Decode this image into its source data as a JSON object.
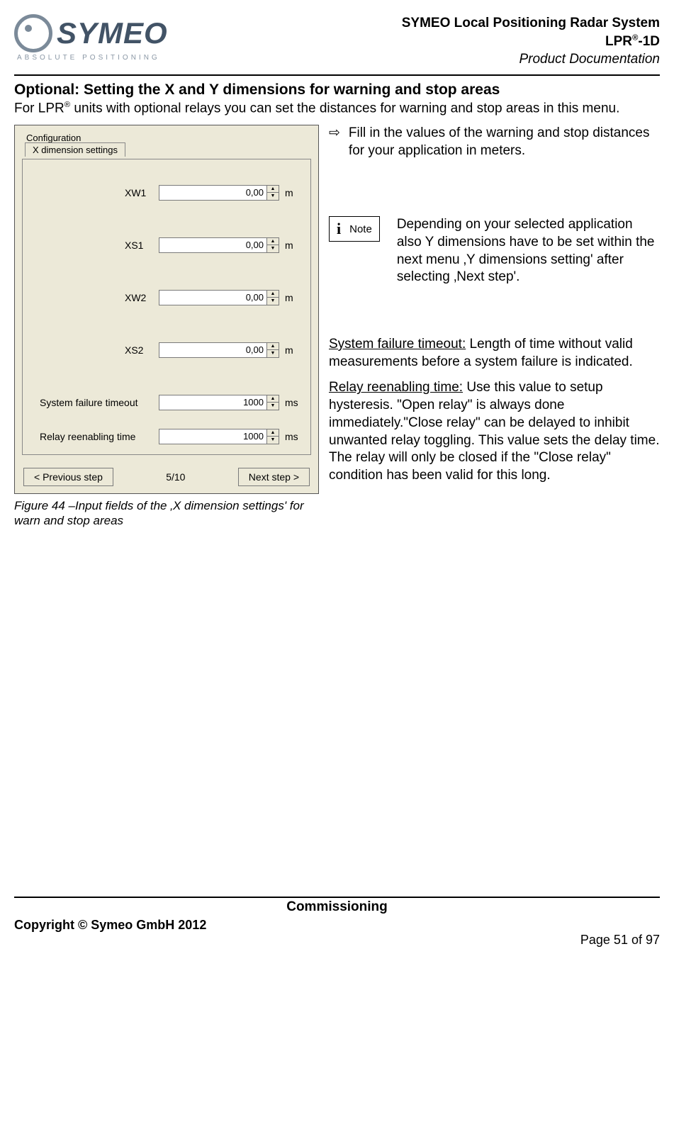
{
  "header": {
    "logo_text": "SYMEO",
    "logo_sub": "ABSOLUTE POSITIONING",
    "title_line1": "SYMEO Local Positioning Radar System",
    "title_line2_a": "LPR",
    "title_line2_sup": "®",
    "title_line2_b": "-1D",
    "title_line3": "Product Documentation"
  },
  "section": {
    "heading": "Optional: Setting the X and Y dimensions for warning and stop areas",
    "intro_a": "For LPR",
    "intro_sup": "®",
    "intro_b": " units with optional relays you can set the distances for warning and stop areas in this menu."
  },
  "dialog": {
    "group_label": "Configuration",
    "tab_label": "X dimension settings",
    "rows": [
      {
        "label": "XW1",
        "value": "0,00",
        "unit": "m"
      },
      {
        "label": "XS1",
        "value": "0,00",
        "unit": "m"
      },
      {
        "label": "XW2",
        "value": "0,00",
        "unit": "m"
      },
      {
        "label": "XS2",
        "value": "0,00",
        "unit": "m"
      },
      {
        "label": "System failure timeout",
        "value": "1000",
        "unit": "ms"
      },
      {
        "label": "Relay reenabling time",
        "value": "1000",
        "unit": "ms"
      }
    ],
    "prev_btn": "< Previous step",
    "step_indicator": "5/10",
    "next_btn": "Next step >"
  },
  "figure_caption": "Figure 44 –Input fields of the ‚X dimension settings' for warn and stop areas",
  "right": {
    "bullet_arrow": "⇨",
    "bullet_text": "Fill in the values of the warning and stop distances for your application in meters.",
    "note_label": "Note",
    "note_body": "Depending on your selected application also Y dimensions have to be set within the next menu ‚Y dimensions setting' after selecting ‚Next step'.",
    "sft_label": "System failure timeout:",
    "sft_body": " Length of time without valid measurements before a system failure is indicated.",
    "rrt_label": "Relay reenabling time:",
    "rrt_body": "  Use this value to setup hysteresis. \"Open relay\" is always done immediately.\"Close relay\" can be delayed to inhibit unwanted relay toggling. This value sets the delay time. The relay will only be closed if the \"Close relay\" condition has been valid for this long."
  },
  "footer": {
    "center": "Commissioning",
    "copyright": "Copyright © Symeo GmbH 2012",
    "page": "Page 51 of 97"
  }
}
